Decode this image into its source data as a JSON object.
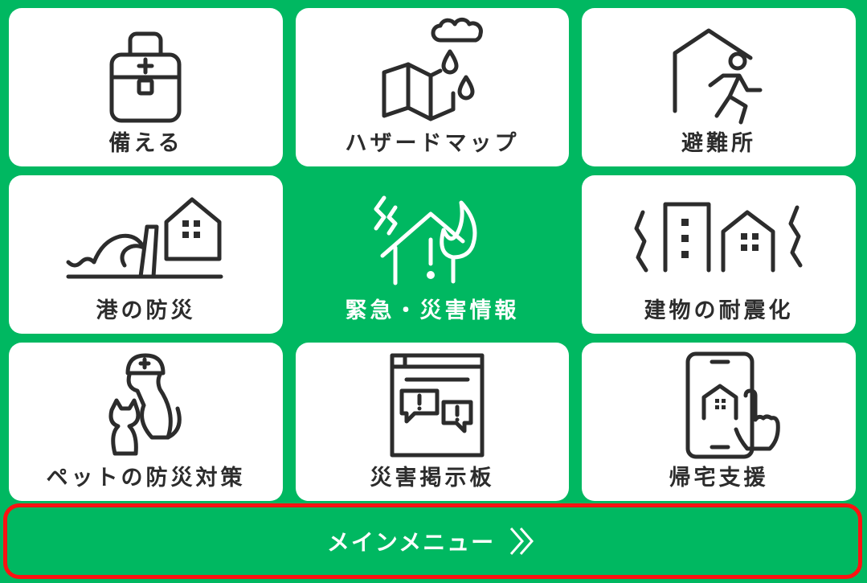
{
  "tiles": [
    {
      "label": "備える",
      "icon": "emergency-bag-icon"
    },
    {
      "label": "ハザードマップ",
      "icon": "hazard-map-icon"
    },
    {
      "label": "避難所",
      "icon": "evacuation-shelter-icon"
    },
    {
      "label": "港の防災",
      "icon": "tsunami-wave-icon"
    },
    {
      "label": "緊急・災害情報",
      "icon": "disaster-house-icon"
    },
    {
      "label": "建物の耐震化",
      "icon": "earthquake-building-icon"
    },
    {
      "label": "ペットの防災対策",
      "icon": "pet-helmet-icon"
    },
    {
      "label": "災害掲示板",
      "icon": "message-board-icon"
    },
    {
      "label": "帰宅支援",
      "icon": "smartphone-tap-icon"
    }
  ],
  "menu": {
    "label": "メインメニュー",
    "icon": "double-chevron-right-icon"
  },
  "colors": {
    "background": "#00b861",
    "tile": "#ffffff",
    "highlight_border": "#ff1212",
    "ink": "#2c2c2c"
  }
}
